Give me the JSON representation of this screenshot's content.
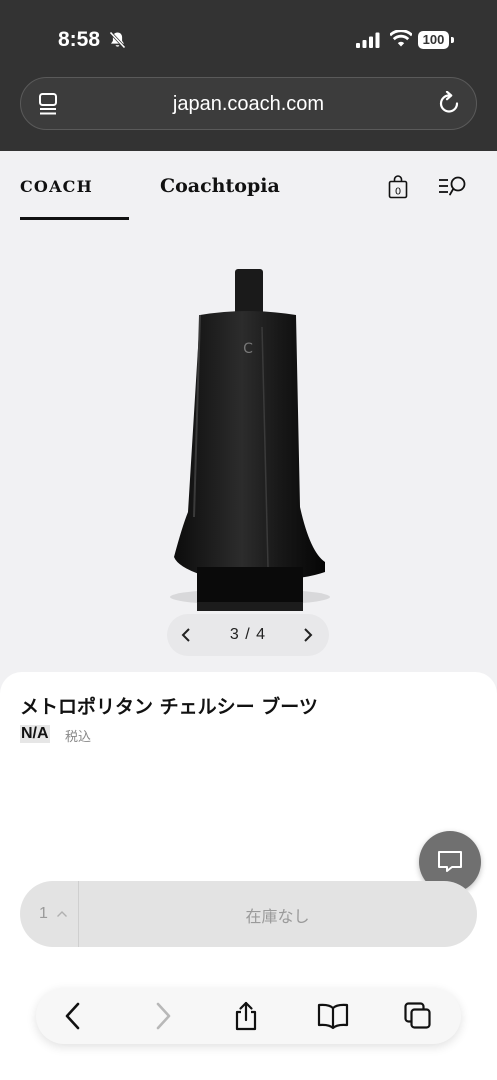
{
  "status_bar": {
    "time": "8:58",
    "battery": "100",
    "icons": [
      "bell-off-icon",
      "signal-icon",
      "wifi-icon",
      "battery-icon"
    ]
  },
  "browser": {
    "url": "japan.coach.com",
    "left_icon": "page-menu-icon",
    "right_icon": "reload-icon"
  },
  "site_header": {
    "logo": "COACH",
    "brand_tab": "Coachtopia",
    "cart_count": "0",
    "icons": [
      "shopping-bag-icon",
      "menu-search-icon"
    ]
  },
  "gallery": {
    "current": "3",
    "separator": "/",
    "total": "4",
    "pager_text": "3 / 4"
  },
  "product": {
    "title": "メトロポリタン チェルシー ブーツ",
    "price": "N/A",
    "tax_note": "税込"
  },
  "purchase": {
    "quantity": "1",
    "stock_label": "在庫なし"
  },
  "safari_toolbar": {
    "icons": [
      "back-icon",
      "forward-icon",
      "share-icon",
      "bookmarks-icon",
      "tabs-icon"
    ]
  },
  "colors": {
    "topbar": "#333333",
    "page_bg": "#f1f1f3",
    "cart_button": "#e3e3e3",
    "chat_button": "#707070"
  }
}
